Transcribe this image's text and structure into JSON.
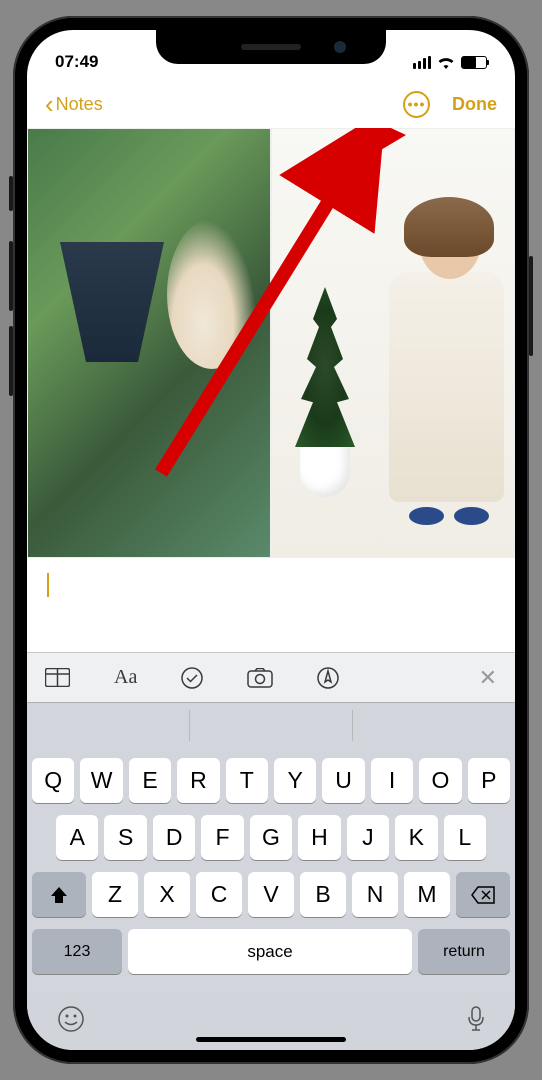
{
  "status": {
    "time": "07:49"
  },
  "nav": {
    "back_label": "Notes",
    "done_label": "Done"
  },
  "toolbar": {
    "icons": [
      "table-icon",
      "text-format-icon",
      "checklist-icon",
      "camera-icon",
      "markup-icon",
      "close-icon"
    ]
  },
  "keyboard": {
    "row1": [
      "Q",
      "W",
      "E",
      "R",
      "T",
      "Y",
      "U",
      "I",
      "O",
      "P"
    ],
    "row2": [
      "A",
      "S",
      "D",
      "F",
      "G",
      "H",
      "J",
      "K",
      "L"
    ],
    "row3": [
      "Z",
      "X",
      "C",
      "V",
      "B",
      "N",
      "M"
    ],
    "numbers_label": "123",
    "space_label": "space",
    "return_label": "return"
  },
  "annotation": {
    "type": "arrow",
    "color": "#d60000",
    "target": "done-button"
  }
}
